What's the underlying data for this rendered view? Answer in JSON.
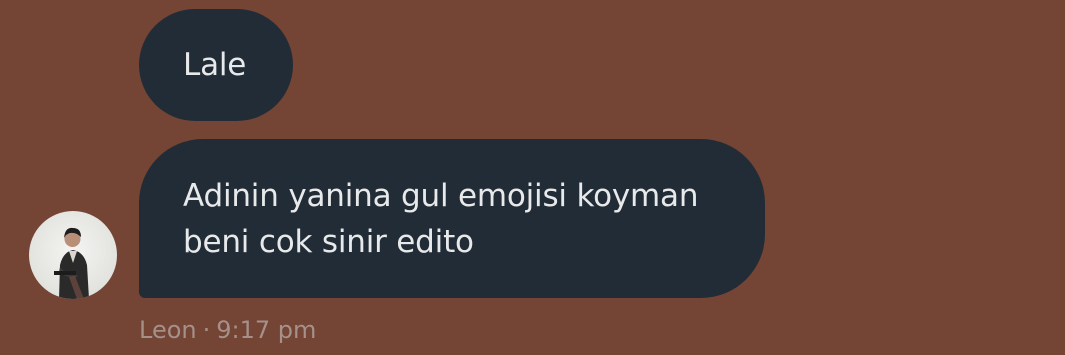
{
  "messages": [
    {
      "text": "Lale"
    },
    {
      "text": "Adinin yanina gul emojisi koyman beni cok sinir edito"
    }
  ],
  "sender": {
    "name": "Leon",
    "avatar_icon": "person-photo-avatar"
  },
  "meta": {
    "separator": "·",
    "time": "9:17 pm"
  },
  "colors": {
    "background": "#744434",
    "bubble": "#222c36",
    "text": "#e7e9ea",
    "meta_text": "#a5908a"
  }
}
